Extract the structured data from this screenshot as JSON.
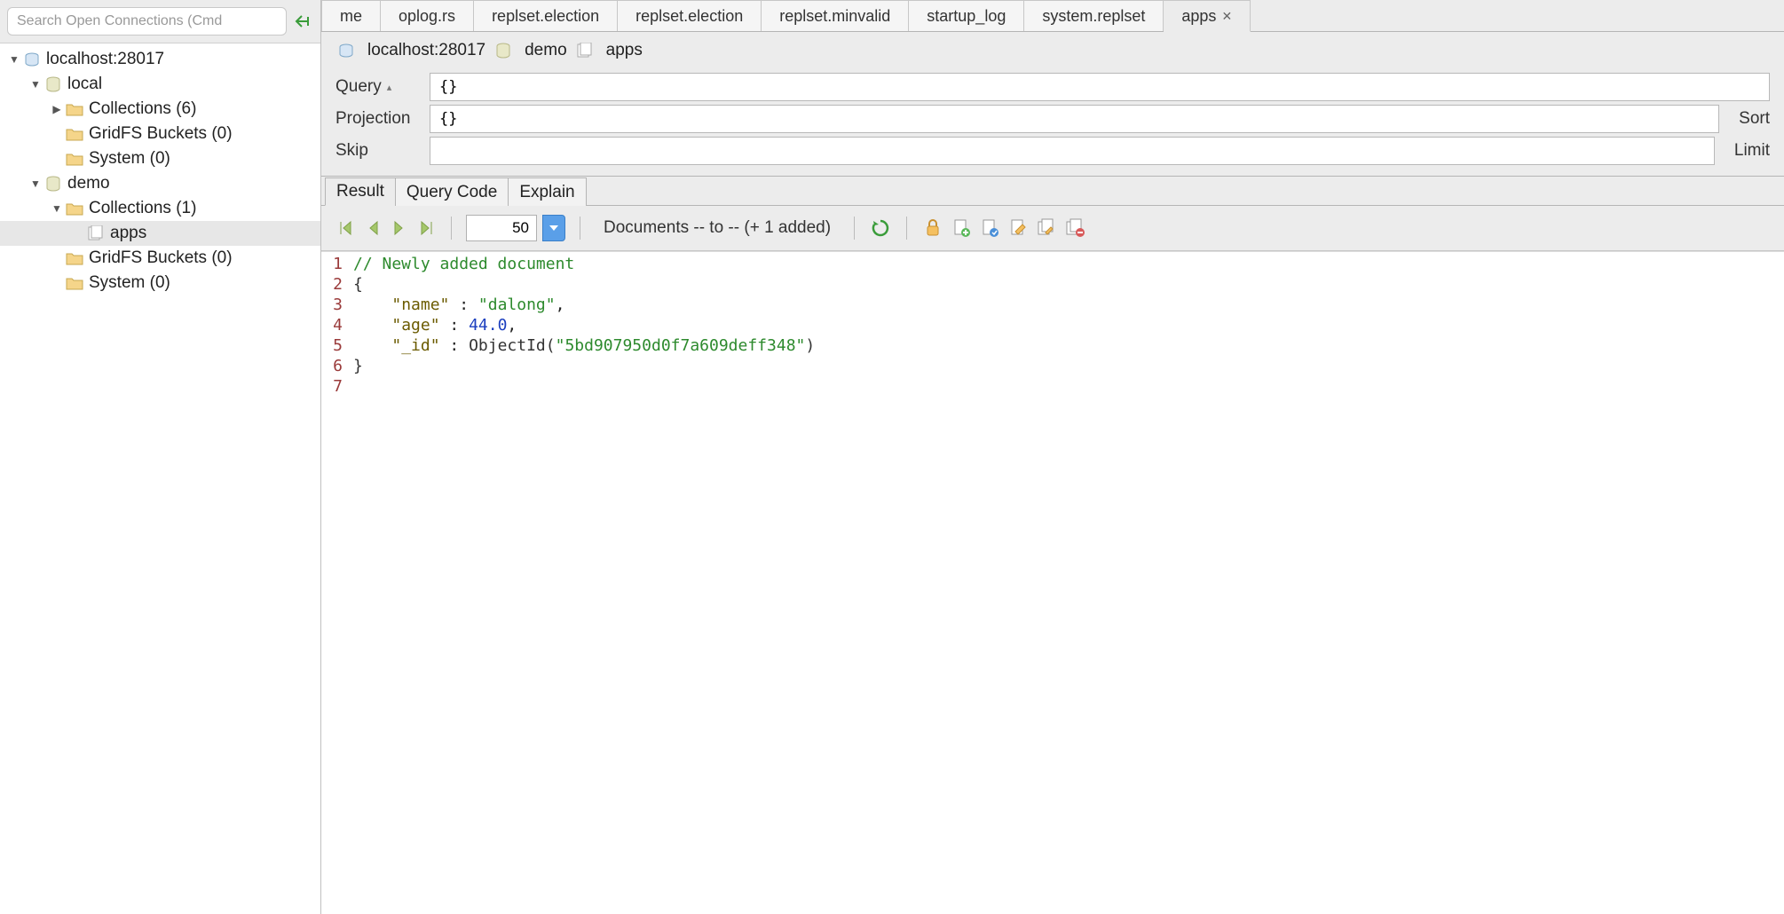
{
  "sidebar": {
    "search_placeholder": "Search Open Connections (Cmd",
    "tree": {
      "host": "localhost:28017",
      "db_local": {
        "name": "local",
        "collections_label": "Collections (6)",
        "gridfs_label": "GridFS Buckets (0)",
        "system_label": "System (0)"
      },
      "db_demo": {
        "name": "demo",
        "collections_label": "Collections (1)",
        "apps_label": "apps",
        "gridfs_label": "GridFS Buckets (0)",
        "system_label": "System (0)"
      }
    }
  },
  "tabs": [
    {
      "label": "me"
    },
    {
      "label": "oplog.rs"
    },
    {
      "label": "replset.election"
    },
    {
      "label": "replset.election"
    },
    {
      "label": "replset.minvalid"
    },
    {
      "label": "startup_log"
    },
    {
      "label": "system.replset"
    },
    {
      "label": "apps",
      "active": true,
      "closeable": true
    }
  ],
  "breadcrumb": {
    "host": "localhost:28017",
    "db": "demo",
    "coll": "apps"
  },
  "query": {
    "query_label": "Query",
    "query_value": "{}",
    "projection_label": "Projection",
    "projection_value": "{}",
    "sort_label": "Sort",
    "skip_label": "Skip",
    "skip_value": "",
    "limit_label": "Limit"
  },
  "result_tabs": {
    "result": "Result",
    "query_code": "Query Code",
    "explain": "Explain"
  },
  "toolbar": {
    "page_size": "50",
    "documents_label": "Documents -- to -- (+ 1 added)"
  },
  "editor": {
    "lines": [
      "1",
      "2",
      "3",
      "4",
      "5",
      "6",
      "7"
    ],
    "doc": {
      "comment": "// Newly added document",
      "name_key": "\"name\"",
      "name_val": "\"dalong\"",
      "age_key": "\"age\"",
      "age_val": "44.0",
      "id_key": "\"_id\"",
      "id_fn": "ObjectId(",
      "id_val": "\"5bd907950d0f7a609deff348\"",
      "id_close": ")"
    }
  }
}
